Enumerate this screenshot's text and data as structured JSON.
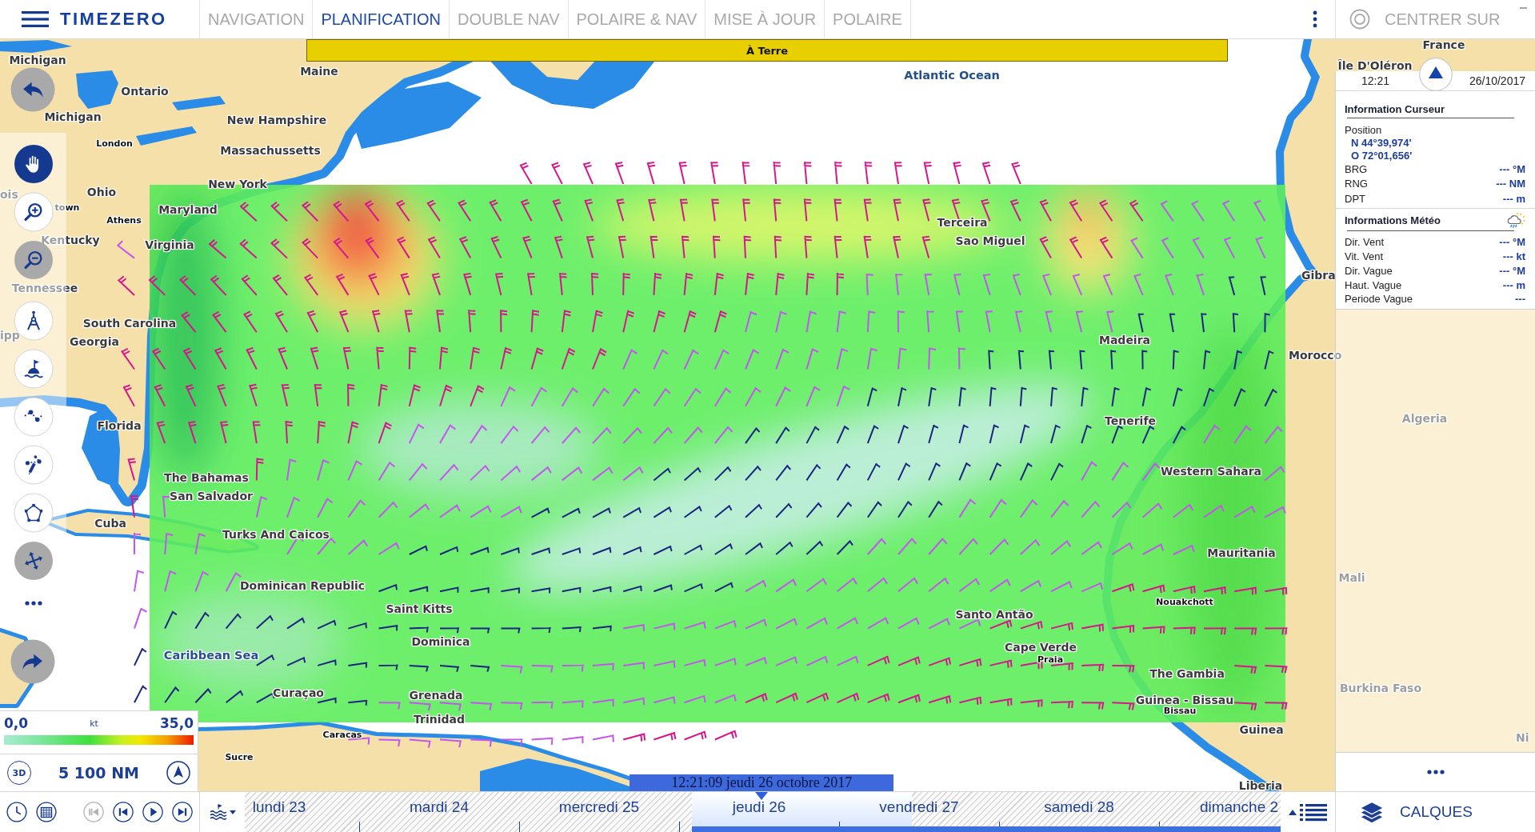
{
  "header": {
    "brand": "TIMEZERO",
    "tabs": [
      {
        "label": "NAVIGATION",
        "selected": false
      },
      {
        "label": "PLANIFICATION",
        "selected": true
      },
      {
        "label": "DOUBLE NAV",
        "selected": false
      },
      {
        "label": "POLAIRE & NAV",
        "selected": false
      },
      {
        "label": "MISE À JOUR",
        "selected": false
      },
      {
        "label": "POLAIRE",
        "selected": false
      }
    ],
    "center_on": "CENTRER SUR"
  },
  "banner": "À Terre",
  "map": {
    "labels": [
      {
        "text": "France",
        "kind": "place"
      },
      {
        "text": "Michigan",
        "kind": "place"
      },
      {
        "text": "Maine",
        "kind": "place"
      },
      {
        "text": "Atlantic Ocean",
        "kind": "sea"
      },
      {
        "text": "Île D'Oléron",
        "kind": "place"
      },
      {
        "text": "Ontario",
        "kind": "place"
      },
      {
        "text": "Michigan",
        "kind": "place"
      },
      {
        "text": "New Hampshire",
        "kind": "place"
      },
      {
        "text": "London",
        "kind": "city"
      },
      {
        "text": "Massachussetts",
        "kind": "place"
      },
      {
        "text": "ois",
        "kind": "place"
      },
      {
        "text": "Ohio",
        "kind": "place"
      },
      {
        "text": "New York",
        "kind": "place"
      },
      {
        "text": "town",
        "kind": "city"
      },
      {
        "text": "Maryland",
        "kind": "place"
      },
      {
        "text": "Athens",
        "kind": "city"
      },
      {
        "text": "Terceira",
        "kind": "place"
      },
      {
        "text": "Kentucky",
        "kind": "place"
      },
      {
        "text": "Virginia",
        "kind": "place"
      },
      {
        "text": "Sao Miguel",
        "kind": "place"
      },
      {
        "text": "Gibra",
        "kind": "place"
      },
      {
        "text": "Tennessee",
        "kind": "place"
      },
      {
        "text": "South Carolina",
        "kind": "place"
      },
      {
        "text": "ipp",
        "kind": "place"
      },
      {
        "text": "Georgia",
        "kind": "place"
      },
      {
        "text": "Madeira",
        "kind": "place"
      },
      {
        "text": "Morocco",
        "kind": "place"
      },
      {
        "text": "Florida",
        "kind": "place"
      },
      {
        "text": "Tenerife",
        "kind": "place"
      },
      {
        "text": "Algeria",
        "kind": "place"
      },
      {
        "text": "The Bahamas",
        "kind": "place"
      },
      {
        "text": "Western Sahara",
        "kind": "place"
      },
      {
        "text": "San Salvador",
        "kind": "place"
      },
      {
        "text": "Cuba",
        "kind": "place"
      },
      {
        "text": "Turks And Caicos",
        "kind": "place"
      },
      {
        "text": "Mauritania",
        "kind": "place"
      },
      {
        "text": "Dominican Republic",
        "kind": "place"
      },
      {
        "text": "Mali",
        "kind": "place"
      },
      {
        "text": "Saint Kitts",
        "kind": "place"
      },
      {
        "text": "Nouakchott",
        "kind": "city"
      },
      {
        "text": "Santo Antão",
        "kind": "place"
      },
      {
        "text": "Dominica",
        "kind": "place"
      },
      {
        "text": "Caribbean Sea",
        "kind": "sea"
      },
      {
        "text": "Cape Verde",
        "kind": "place"
      },
      {
        "text": "Praia",
        "kind": "city"
      },
      {
        "text": "The Gambia",
        "kind": "place"
      },
      {
        "text": "Curaçao",
        "kind": "place"
      },
      {
        "text": "Grenada",
        "kind": "place"
      },
      {
        "text": "Burkina Faso",
        "kind": "place"
      },
      {
        "text": "Guinea - Bissau",
        "kind": "place"
      },
      {
        "text": "Bissau",
        "kind": "city"
      },
      {
        "text": "Trinidad",
        "kind": "place"
      },
      {
        "text": "Caracas",
        "kind": "city"
      },
      {
        "text": "Guinea",
        "kind": "place"
      },
      {
        "text": "Ni",
        "kind": "place"
      },
      {
        "text": "Sucre",
        "kind": "city"
      },
      {
        "text": "Liberia",
        "kind": "place"
      }
    ]
  },
  "toolbar": {
    "back": {
      "disabled": true
    },
    "forward": {
      "disabled": true
    },
    "tools": [
      {
        "kind": "hand",
        "selected": true,
        "disabled": false
      },
      {
        "kind": "zoom_in",
        "selected": false,
        "disabled": false
      },
      {
        "kind": "zoom_out",
        "selected": false,
        "disabled": true
      },
      {
        "kind": "dividers",
        "selected": false,
        "disabled": false
      },
      {
        "kind": "buoy",
        "selected": false,
        "disabled": false
      },
      {
        "kind": "route",
        "selected": false,
        "disabled": false
      },
      {
        "kind": "route_edit",
        "selected": false,
        "disabled": false
      },
      {
        "kind": "polygon",
        "selected": false,
        "disabled": false
      },
      {
        "kind": "move",
        "selected": false,
        "disabled": true
      }
    ]
  },
  "legend": {
    "min": "0,0",
    "unit": "kt",
    "max": "35,0"
  },
  "scale": {
    "mode": "3D",
    "distance": "5 100 NM"
  },
  "info_panel": {
    "time": "12:21",
    "date": "26/10/2017",
    "cursor": {
      "title": "Information Curseur",
      "position_label": "Position",
      "coordinates": [
        "N 44°39,974'",
        "O 72°01,656'"
      ],
      "rows": [
        {
          "label": "BRG",
          "value": "--- °M"
        },
        {
          "label": "RNG",
          "value": "--- NM"
        },
        {
          "label": "DPT",
          "value": "--- m"
        }
      ]
    },
    "weather": {
      "title": "Informations Météo",
      "rows": [
        {
          "label": "Dir. Vent",
          "value": "--- °M"
        },
        {
          "label": "Vit. Vent",
          "value": "--- kt"
        },
        {
          "label": "Dir. Vague",
          "value": "--- °M"
        },
        {
          "label": "Haut. Vague",
          "value": "--- m"
        },
        {
          "label": "Periode Vague",
          "value": "---"
        }
      ]
    }
  },
  "timeline": {
    "current": "12:21:09 jeudi 26 octobre 2017",
    "level": 0.499,
    "days": [
      "lundi 23",
      "mardi 24",
      "mercredi 25",
      "jeudi 26",
      "vendredi 27",
      "samedi 28",
      "dimanche 2"
    ]
  },
  "playback": [
    {
      "kind": "first",
      "disabled": true
    },
    {
      "kind": "previous",
      "disabled": false
    },
    {
      "kind": "play",
      "disabled": false
    },
    {
      "kind": "next",
      "disabled": false
    }
  ],
  "layers_button": "CALQUES"
}
